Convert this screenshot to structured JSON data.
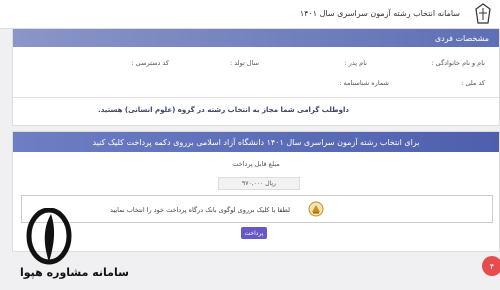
{
  "header": {
    "title": "سامانه انتخاب رشته آزمون سراسری سال ۱۴۰۱"
  },
  "personal": {
    "section_title": "مشخصات فردی",
    "first_last_name_label": "نام و نام خانوادگی :",
    "father_name_label": "نام پدر :",
    "birth_year_label": "سال تولد :",
    "access_code_label": "کد دسترسی :",
    "national_code_label": "کد ملی :",
    "id_number_label": "شماره شناسنامه :",
    "eligibility_notice": "داوطلب گرامی شما مجاز به انتخاب رشته در گروه (علوم انسانی) هستید."
  },
  "payment": {
    "banner": "برای انتخاب رشته آزمون سراسری سال ۱۴۰۱ دانشگاه آزاد اسلامی برروی دکمه پرداخت کلیک کنید",
    "amount_label": "مبلغ قابل پرداخت",
    "amount_value": "۹۷۰,۰۰۰ ریال",
    "bank_instruction": "لطفا با کلیک برروی لوگوی بانک درگاه پرداخت خود را انتخاب نمایید",
    "pay_button": "پرداخت"
  },
  "watermark": {
    "text": "سامانه مشاوره هپوا"
  },
  "fab": {
    "label": "۴"
  },
  "icons": {
    "top_logo": "university-emblem-icon",
    "bank_logo": "bank-melli-logo-icon",
    "watermark_logo": "hopa-quill-logo-icon"
  },
  "colors": {
    "header_gradient": "#5f6fb5",
    "button": "#6658c9",
    "fab": "#e84b4b"
  }
}
